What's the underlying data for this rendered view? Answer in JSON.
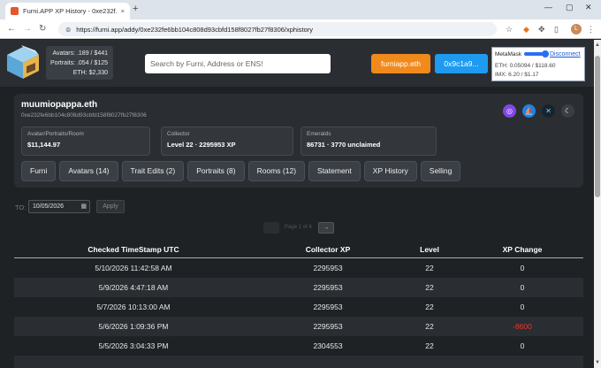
{
  "browser": {
    "tab_title": "Furni.APP XP History - 0xe232f...",
    "tab_close": "×",
    "new_tab": "+",
    "url": "https://furni.app/addy/0xe232fe6bb104c808d93cbfd158f8027fb27f8306/xphistory",
    "profile_initial": "L"
  },
  "header": {
    "stats": {
      "avatars": "Avatars: .189 / $441",
      "portraits": "Portraits: .054 / $125",
      "eth": "ETH: $2,330"
    },
    "search_placeholder": "Search by Furni, Address or ENS!",
    "ens_button": "furniapp.eth",
    "wallet_button": "0x9c1a9...",
    "metamask": {
      "label": "MetaMask",
      "disconnect": "Disconnect",
      "eth": "ETH: 0.05094 / $118.60",
      "imx": "IMX: 6.20 / $1.17"
    }
  },
  "profile": {
    "name": "muumiopappa.eth",
    "address": "0xe232fe6bb104c808d93cbfd158f8027fb27f8306",
    "boxes": [
      {
        "label": "Avatar/Portraits/Room",
        "value": "$11,144.97"
      },
      {
        "label": "Collector",
        "value": "Level 22 · 2295953 XP"
      },
      {
        "label": "Emeralds",
        "value": "86731 · 3770 unclaimed"
      }
    ],
    "nav": [
      "Furni",
      "Avatars (14)",
      "Trait Edits (2)",
      "Portraits (8)",
      "Rooms (12)",
      "Statement",
      "XP History",
      "Selling"
    ]
  },
  "filter": {
    "to_label": "TO:",
    "date_value": "10/05/2026",
    "apply_label": "Apply"
  },
  "pager": {
    "text": "Page 1 of 4",
    "next": "→"
  },
  "table": {
    "headers": [
      "Checked TimeStamp UTC",
      "Collector XP",
      "Level",
      "XP Change"
    ],
    "rows": [
      [
        "5/10/2026 11:42:58 AM",
        "2295953",
        "22",
        "0"
      ],
      [
        "5/9/2026 4:47:18 AM",
        "2295953",
        "22",
        "0"
      ],
      [
        "5/7/2026 10:13:00 AM",
        "2295953",
        "22",
        "0"
      ],
      [
        "5/6/2026 1:09:36 PM",
        "2295953",
        "22",
        "-8600"
      ],
      [
        "5/5/2026 3:04:33 PM",
        "2304553",
        "22",
        "0"
      ]
    ]
  },
  "colors": {
    "accent_orange": "#f08a1c",
    "accent_blue": "#1e9bf0",
    "negative": "#e53935",
    "row_alt": "#2a2d31"
  }
}
